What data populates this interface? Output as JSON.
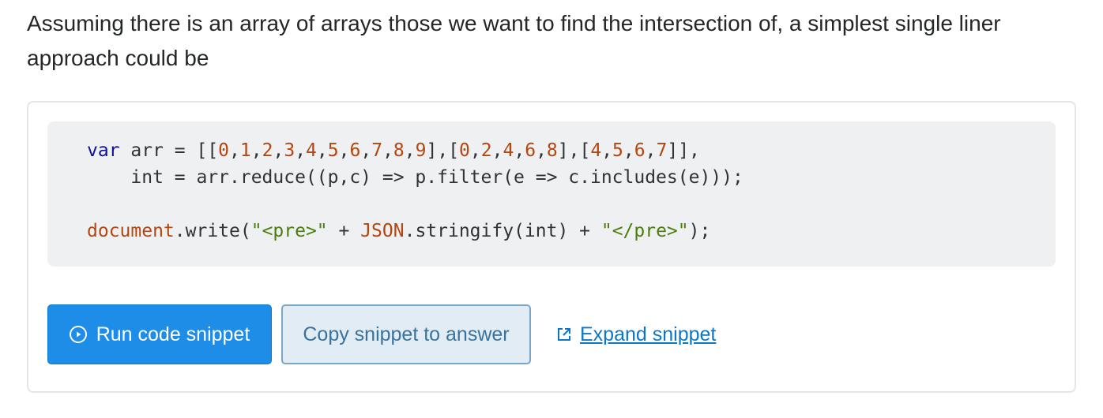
{
  "intro": {
    "text": "Assuming there is an array of arrays those we want to find the intersection of, a simplest single liner approach could be"
  },
  "code": {
    "line1": {
      "t1": "var",
      "t2": " arr = [[",
      "n1": "0",
      "c1": ",",
      "n2": "1",
      "c2": ",",
      "n3": "2",
      "c3": ",",
      "n4": "3",
      "c4": ",",
      "n5": "4",
      "c5": ",",
      "n6": "5",
      "c6": ",",
      "n7": "6",
      "c7": ",",
      "n8": "7",
      "c8": ",",
      "n9": "8",
      "c9": ",",
      "n10": "9",
      "c10": "],[",
      "n11": "0",
      "c11": ",",
      "n12": "2",
      "c12": ",",
      "n13": "4",
      "c13": ",",
      "n14": "6",
      "c14": ",",
      "n15": "8",
      "c15": "],[",
      "n16": "4",
      "c16": ",",
      "n17": "5",
      "c17": ",",
      "n18": "6",
      "c18": ",",
      "n19": "7",
      "c19": "]],"
    },
    "line2": "    int = arr.reduce((p,c) => p.filter(e => c.includes(e)));",
    "line4": {
      "obj1": "document",
      "p1": ".write(",
      "s1": "\"<pre>\"",
      "p2": " + ",
      "obj2": "JSON",
      "p3": ".stringify(int) + ",
      "s2": "\"</pre>\"",
      "p4": ");"
    }
  },
  "buttons": {
    "run_label": "Run code snippet",
    "run_icon": "play-circle-icon",
    "copy_label": "Copy snippet to answer",
    "expand_label": "Expand snippet",
    "expand_icon": "external-link-icon"
  },
  "colors": {
    "run_bg": "#1d8de8",
    "copy_bg": "#e1ecf4",
    "link": "#0c77c7",
    "keyword": "#101094",
    "number": "#b5460f",
    "string": "#4c7d0c"
  }
}
